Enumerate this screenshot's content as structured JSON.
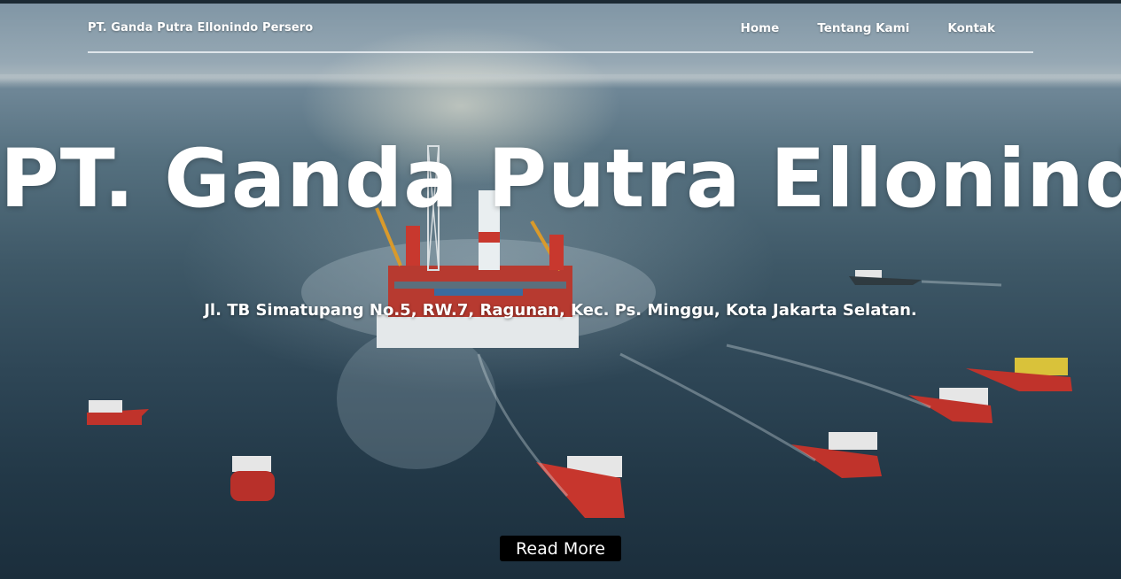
{
  "header": {
    "brand": "PT. Ganda Putra Ellonindo Persero",
    "nav": [
      {
        "label": "Home"
      },
      {
        "label": "Tentang Kami"
      },
      {
        "label": "Kontak"
      }
    ]
  },
  "hero": {
    "title": "PT. Ganda Putra Ellonindo",
    "address": "Jl. TB Simatupang No.5, RW.7, Ragunan, Kec. Ps. Minggu, Kota Jakarta Selatan.",
    "cta_label": "Read More",
    "background": "offshore-platform-with-ships-image"
  },
  "colors": {
    "text": "#ffffff",
    "button_bg": "#000000",
    "sea_dark": "#1b2e3c",
    "ship_red": "#c0332b"
  }
}
